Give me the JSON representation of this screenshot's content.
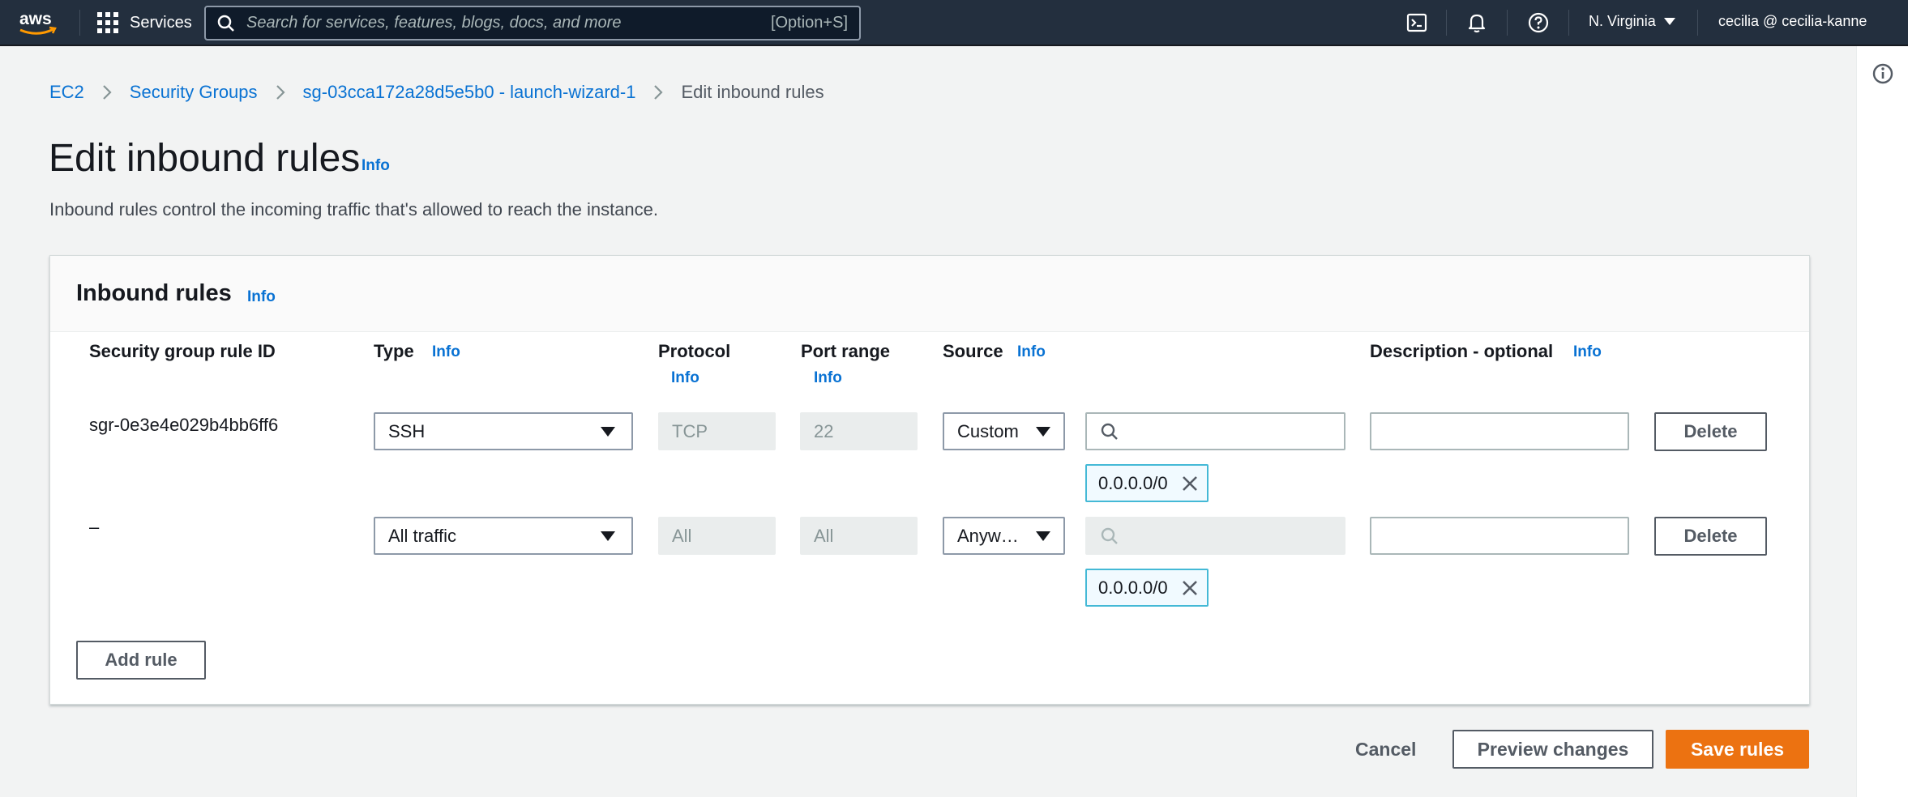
{
  "nav": {
    "logo_text": "aws",
    "services_label": "Services",
    "search_placeholder": "Search for services, features, blogs, docs, and more",
    "search_shortcut": "[Option+S]",
    "region": "N. Virginia",
    "account": "cecilia @ cecilia-kanne"
  },
  "breadcrumb": {
    "items": [
      "EC2",
      "Security Groups",
      "sg-03cca172a28d5e5b0 - launch-wizard-1"
    ],
    "current": "Edit inbound rules"
  },
  "page": {
    "title": "Edit inbound rules",
    "info": "Info",
    "description": "Inbound rules control the incoming traffic that's allowed to reach the instance."
  },
  "panel": {
    "title": "Inbound rules",
    "info": "Info",
    "columns": {
      "rule_id": "Security group rule ID",
      "type": "Type",
      "protocol": "Protocol",
      "port_range": "Port range",
      "source": "Source",
      "description": "Description - optional",
      "info": "Info"
    },
    "rows": [
      {
        "rule_id": "sgr-0e3e4e029b4bb6ff6",
        "type": "SSH",
        "protocol": "TCP",
        "port_range": "22",
        "source": "Custom",
        "cidr": "0.0.0.0/0",
        "description": "",
        "delete": "Delete"
      },
      {
        "rule_id": "–",
        "type": "All traffic",
        "protocol": "All",
        "port_range": "All",
        "source": "Anyw…",
        "cidr": "0.0.0.0/0",
        "description": "",
        "delete": "Delete"
      }
    ],
    "add_rule": "Add rule"
  },
  "footer": {
    "cancel": "Cancel",
    "preview": "Preview changes",
    "save": "Save rules"
  },
  "colors": {
    "nav_bg": "#232f3e",
    "link": "#0972d3",
    "primary": "#ec7211",
    "token_border": "#44b9d6"
  }
}
